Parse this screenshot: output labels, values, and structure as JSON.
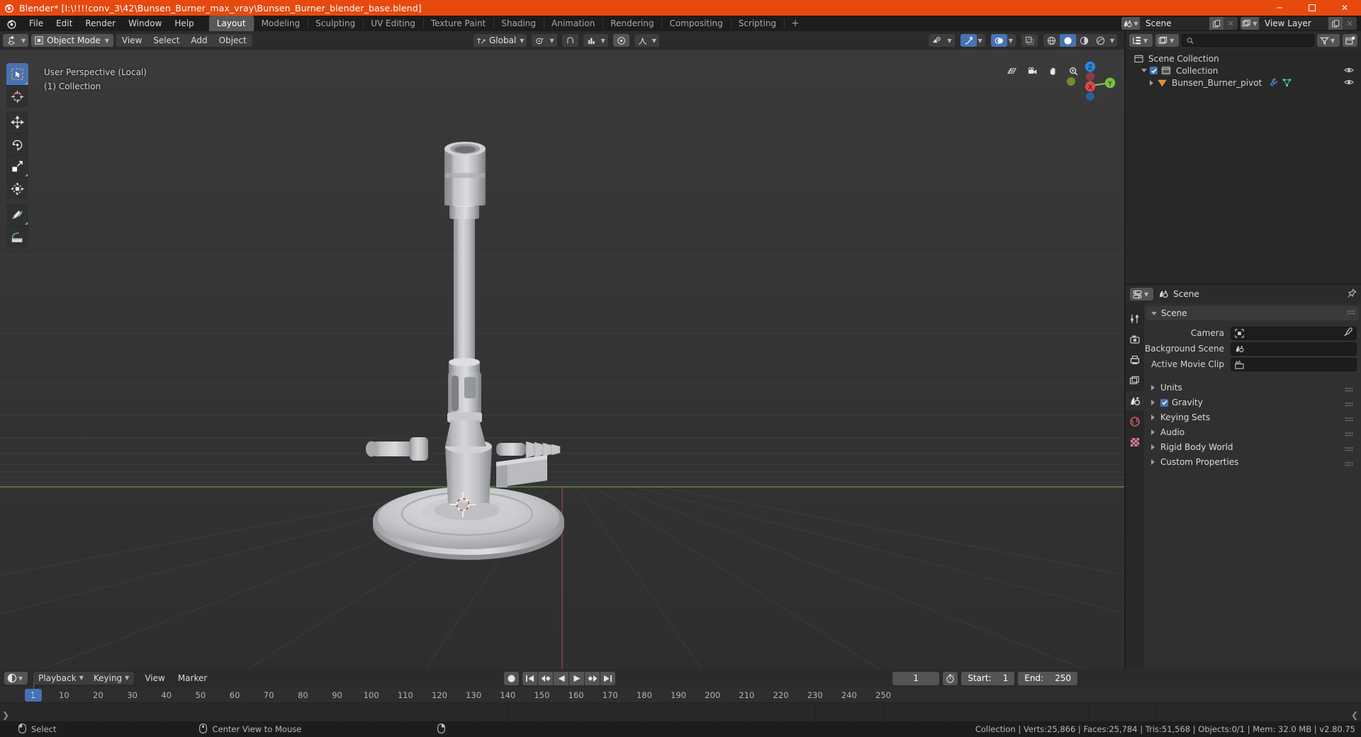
{
  "titlebar": {
    "title": "Blender* [I:\\!!!!conv_3\\42\\Bunsen_Burner_max_vray\\Bunsen_Burner_blender_base.blend]",
    "minimize": "─",
    "maximize": "☐",
    "close": "✕"
  },
  "topbar": {
    "menus": [
      "File",
      "Edit",
      "Render",
      "Window",
      "Help"
    ],
    "workspaces": [
      {
        "label": "Layout",
        "active": true
      },
      {
        "label": "Modeling",
        "active": false
      },
      {
        "label": "Sculpting",
        "active": false
      },
      {
        "label": "UV Editing",
        "active": false
      },
      {
        "label": "Texture Paint",
        "active": false
      },
      {
        "label": "Shading",
        "active": false
      },
      {
        "label": "Animation",
        "active": false
      },
      {
        "label": "Rendering",
        "active": false
      },
      {
        "label": "Compositing",
        "active": false
      },
      {
        "label": "Scripting",
        "active": false
      }
    ],
    "add_workspace": "+",
    "scene": {
      "name": "Scene",
      "icon": "scene-icon",
      "new_label": "❐",
      "unlink_label": "✕"
    },
    "view_layer": {
      "name": "View Layer",
      "icon": "viewlayer-icon",
      "new_label": "❐",
      "unlink_label": "✕"
    }
  },
  "viewport": {
    "header": {
      "editor_type": "editor-type-icon",
      "mode": "Object Mode",
      "menus": [
        "View",
        "Select",
        "Add",
        "Object"
      ],
      "transform_orientation": "Global",
      "pivot_icon": "pivot-icon",
      "snap_icon": "snap-magnet-icon",
      "snap_target_icon": "snap-target-icon",
      "proportional_icon": "proportional-edit-icon",
      "falloff_icon": "falloff-curve-icon",
      "visibility_icon": "visibility-icon",
      "gizmo_icon": "gizmo-icon",
      "overlays_icon": "overlays-icon",
      "xray_icon": "xray-icon",
      "shading_modes": [
        "wireframe",
        "solid",
        "material-preview",
        "rendered"
      ],
      "shading_active_index": 1
    },
    "overlay_text": {
      "perspective": "User Perspective (Local)",
      "collection": "(1) Collection"
    },
    "tools": [
      {
        "name": "select-box-tool",
        "active": true
      },
      {
        "name": "cursor-tool",
        "active": false
      },
      {
        "name": "move-tool",
        "active": false
      },
      {
        "name": "rotate-tool",
        "active": false
      },
      {
        "name": "scale-tool",
        "active": false
      },
      {
        "name": "transform-tool",
        "active": false
      },
      {
        "name": "annotate-tool",
        "active": false
      },
      {
        "name": "measure-tool",
        "active": false
      }
    ],
    "nav_buttons": [
      "grid-view-icon",
      "camera-view-icon",
      "hand-pan-icon",
      "zoom-magnifier-icon"
    ],
    "axis_gizmo": {
      "x": "X",
      "y": "Y",
      "z": "Z"
    }
  },
  "outliner": {
    "display_mode_icon": "outliner-display-icon",
    "filter_id_icon": "scene-filter-icon",
    "search_placeholder": "",
    "search_value": "",
    "filter_icon": "filter-funnel-icon",
    "new_collection_icon": "new-collection-icon",
    "rows": [
      {
        "label": "Scene Collection",
        "depth": 0,
        "icon": "collection-icon",
        "expander": "none",
        "checkbox": false,
        "eye": false
      },
      {
        "label": "Collection",
        "depth": 1,
        "icon": "collection-icon",
        "expander": "down",
        "checkbox": true,
        "eye": true
      },
      {
        "label": "Bunsen_Burner_pivot",
        "depth": 2,
        "icon": "empty-cone-icon",
        "expander": "right",
        "checkbox": false,
        "eye": true,
        "extra_icons": [
          "modifier-wrench-icon",
          "mesh-data-icon"
        ]
      }
    ]
  },
  "properties": {
    "header": {
      "editor_icon": "properties-editor-icon",
      "breadcrumb_icon": "scene-icon",
      "breadcrumb": "Scene",
      "pin_icon": "pin-icon"
    },
    "tabs": [
      {
        "name": "tool-tab",
        "icon": "tool-icon",
        "active": false
      },
      {
        "name": "render-tab",
        "icon": "camera-back-icon",
        "active": false
      },
      {
        "name": "output-tab",
        "icon": "printer-icon",
        "active": false
      },
      {
        "name": "view-layer-tab",
        "icon": "images-icon",
        "active": false
      },
      {
        "name": "scene-tab",
        "icon": "scene-icon",
        "active": true
      },
      {
        "name": "world-tab",
        "icon": "world-icon",
        "active": false
      },
      {
        "name": "texture-tab",
        "icon": "checker-texture-icon",
        "active": false
      }
    ],
    "section_title": "Scene",
    "fields": [
      {
        "label": "Camera",
        "icon": "camera-data-icon",
        "value": "",
        "has_eyedropper": true
      },
      {
        "label": "Background Scene",
        "icon": "scene-icon",
        "value": "",
        "has_eyedropper": false
      },
      {
        "label": "Active Movie Clip",
        "icon": "movie-clip-icon",
        "value": "",
        "has_eyedropper": false
      }
    ],
    "panels": [
      {
        "label": "Units",
        "expanded": false,
        "checkbox": null
      },
      {
        "label": "Gravity",
        "expanded": false,
        "checkbox": true
      },
      {
        "label": "Keying Sets",
        "expanded": false,
        "checkbox": null
      },
      {
        "label": "Audio",
        "expanded": false,
        "checkbox": null
      },
      {
        "label": "Rigid Body World",
        "expanded": false,
        "checkbox": null
      },
      {
        "label": "Custom Properties",
        "expanded": false,
        "checkbox": null
      }
    ]
  },
  "timeline": {
    "editor_icon": "timeline-editor-icon",
    "menus": [
      "Playback",
      "Keying",
      "View",
      "Marker"
    ],
    "playback_controls": [
      {
        "name": "auto-keying-record-button",
        "glyph": "●"
      },
      {
        "name": "jump-to-start-button",
        "glyph": "⏮"
      },
      {
        "name": "jump-to-prev-keyframe-button",
        "glyph": "◀◆"
      },
      {
        "name": "play-reverse-button",
        "glyph": "◀"
      },
      {
        "name": "play-button",
        "glyph": "▶"
      },
      {
        "name": "jump-to-next-keyframe-button",
        "glyph": "◆▶"
      },
      {
        "name": "jump-to-end-button",
        "glyph": "⏭"
      }
    ],
    "current_frame": "1",
    "use_preview_range_icon": "stopwatch-icon",
    "start_label": "Start:",
    "start_value": "1",
    "end_label": "End:",
    "end_value": "250",
    "ruler_ticks": [
      1,
      10,
      20,
      30,
      40,
      50,
      60,
      70,
      80,
      90,
      100,
      110,
      120,
      130,
      140,
      150,
      160,
      170,
      180,
      190,
      200,
      210,
      220,
      230,
      240,
      250
    ],
    "playhead_frame": 1
  },
  "statusbar": {
    "items": [
      {
        "icon": "mouse-left-icon",
        "label": "Select"
      },
      {
        "icon": "mouse-middle-icon",
        "label": "Center View to Mouse"
      },
      {
        "icon": "mouse-right-icon",
        "label": ""
      }
    ],
    "stats": "Collection | Verts:25,866 | Faces:25,784 | Tris:51,568 | Objects:0/1 | Mem: 32.0 MB | v2.80.75"
  },
  "colors": {
    "accent_blue": "#4772b3",
    "title_orange": "#e7490f",
    "viewport_bg": "#393939",
    "panel_bg": "#303030",
    "header_bg": "#2b2b2b",
    "axis_x": "#e0484f",
    "axis_y": "#7bc043",
    "axis_z": "#2f83e3",
    "model_gray": "#c8c8c8"
  }
}
